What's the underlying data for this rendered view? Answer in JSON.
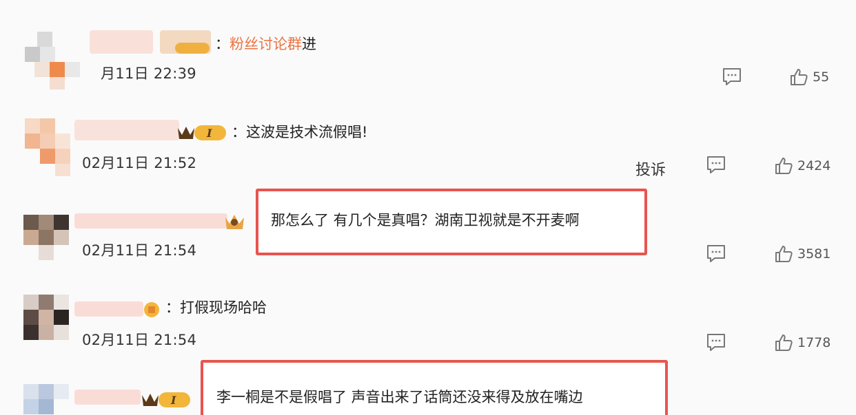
{
  "comments": [
    {
      "prefix": "：",
      "text_highlight": "粉丝讨论群",
      "text_rest": "进",
      "time": "月11日 22:39",
      "likes": "55",
      "report": ""
    },
    {
      "prefix": "：",
      "text": "这波是技术流假唱!",
      "time": "02月11日 21:52",
      "likes": "2424",
      "report": "投诉"
    },
    {
      "text": "那怎么了 有几个是真唱？湖南卫视就是不开麦啊",
      "time": "02月11日 21:54",
      "likes": "3581"
    },
    {
      "prefix": "：",
      "text": "打假现场哈哈",
      "time": "02月11日 21:54",
      "likes": "1778"
    },
    {
      "text": "李一桐是不是假唱了 声音出来了话筒还没来得及放在嘴边"
    }
  ],
  "badge_level": "I",
  "colors": {
    "highlight": "#eb7340",
    "box": "#e8544e"
  },
  "icons": {
    "comment": "comment-bubble-icon",
    "like": "thumbs-up-icon"
  }
}
